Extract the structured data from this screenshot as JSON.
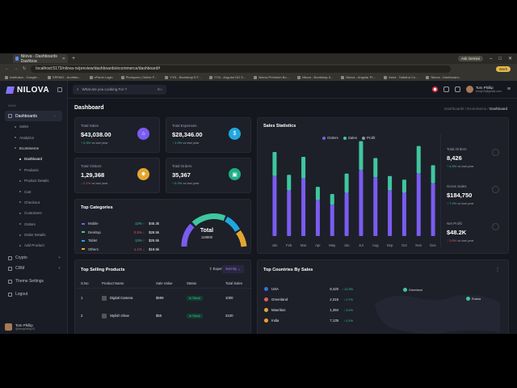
{
  "browser": {
    "tab_title": "Nilova - Dashboards Dashboa",
    "url": "localhost:5173/nilova-rs/preview/dashboards/ecommerce/dashboard#",
    "ask_label": "Ask Gemini",
    "work_label": "Work",
    "bookmarks": [
      "Institution - Google...",
      "SPEMO - Architec...",
      "cPanel Login",
      "Photopea | Online F...",
      "YYN - Bootstrap 5 F...",
      "YYN - Angular NG S...",
      "Nilova Premium Bo...",
      "Nilova - Bootstrap 5...",
      "Nilova - Angular Pr...",
      "Xstra - Tailwind Co...",
      "Nilova - Dashboard..."
    ]
  },
  "sidebar": {
    "logo": "NILOVA",
    "menu_heading": "MAIN",
    "items": [
      {
        "label": "Dashboards",
        "active": true
      },
      {
        "label": "Sales"
      },
      {
        "label": "Analytics"
      },
      {
        "label": "Ecommerce"
      }
    ],
    "sub_items": [
      "Dashboard",
      "Products",
      "Product Details",
      "Cart",
      "Checkout",
      "Customers",
      "Orders",
      "Order Details",
      "Add Product"
    ],
    "bottom_items": [
      "Crypto",
      "CRM",
      "Theme Settings",
      "Logout"
    ],
    "user": {
      "name": "Tom Phillip",
      "handle": "@tomphillip23"
    }
  },
  "topbar": {
    "search_placeholder": "What are you Looking For ?",
    "search_shortcut": "⌘K",
    "user_name": "Tom Phillip",
    "user_email": "tomp23@gmail.com"
  },
  "page": {
    "title": "Dashboard",
    "breadcrumb": [
      "Dashboards",
      "Ecommerce",
      "Dashboard"
    ]
  },
  "stats": [
    {
      "label": "Total Sales",
      "value": "$43,038.00",
      "change": "0.3%",
      "dir": "up",
      "suffix": "vs last year",
      "color": "#7a5cf0",
      "icon": "cart-icon"
    },
    {
      "label": "Total Expenses",
      "value": "$28,346.00",
      "change": "1.0%",
      "dir": "up",
      "suffix": "vs last year",
      "color": "#1fa7e0",
      "icon": "dollar-icon"
    },
    {
      "label": "Total Visitors",
      "value": "1,29,368",
      "change": "2.1%",
      "dir": "dn",
      "suffix": "vs last year",
      "color": "#e3a72f",
      "icon": "user-icon"
    },
    {
      "label": "Total Orders",
      "value": "35,367",
      "change": "0.2%",
      "dir": "up",
      "suffix": "vs last year",
      "color": "#1fae86",
      "icon": "box-icon"
    }
  ],
  "categories": {
    "title": "Top Categories",
    "rows": [
      {
        "name": "Mobile",
        "pct": "13% ↑",
        "amount": "$45.3k",
        "color": "#7a5cf0"
      },
      {
        "name": "Desktop",
        "pct": "0.5% ↓",
        "amount": "$28.5k",
        "color": "#3fc6a0"
      },
      {
        "name": "Tablet",
        "pct": "13% ↑",
        "amount": "$25.5k",
        "color": "#1fa7e0"
      },
      {
        "name": "Others",
        "pct": "1.1% ↓",
        "amount": "$19.6k",
        "color": "#e3a72f"
      }
    ],
    "total_label": "Total",
    "total_value": "118900"
  },
  "sales_stats": {
    "title": "Sales Statistics",
    "legend": [
      {
        "name": "Orders",
        "color": "#7a5cf0"
      },
      {
        "name": "Sales",
        "color": "#3fc6a0"
      },
      {
        "name": "Profit",
        "color": "#8e93a3"
      }
    ],
    "side": [
      {
        "label": "Total Orders",
        "value": "8,426",
        "change": "4.4%",
        "dir": "up",
        "suffix": "vs last year"
      },
      {
        "label": "Gross Sales",
        "value": "$184,750",
        "change": "7.2%",
        "dir": "up",
        "suffix": "vs last year"
      },
      {
        "label": "Net Profit",
        "value": "$48.2K",
        "change": "3.6%",
        "dir": "dn",
        "suffix": "vs last year"
      }
    ]
  },
  "chart_data": {
    "type": "bar",
    "categories": [
      "Jan",
      "Feb",
      "Mar",
      "Apr",
      "May",
      "Jun",
      "Jul",
      "Aug",
      "Sep",
      "Oct",
      "Nov",
      "Dec"
    ],
    "series": [
      {
        "name": "Orders",
        "values": [
          50,
          38,
          48,
          30,
          26,
          36,
          55,
          49,
          38,
          36,
          52,
          44
        ]
      },
      {
        "name": "Sales",
        "values": [
          20,
          13,
          18,
          11,
          9,
          16,
          24,
          16,
          12,
          11,
          23,
          15
        ]
      }
    ],
    "stacked": true,
    "ylim": [
      0,
      100
    ],
    "grid": false,
    "legend_position": "top"
  },
  "products": {
    "title": "Top Selling Products",
    "export_label": "Export",
    "sort_label": "Sort By",
    "columns": [
      "S.No",
      "Product Name",
      "Sale Value",
      "Status",
      "Total Sales"
    ],
    "rows": [
      {
        "no": "1",
        "name": "Digital Camera",
        "value": "$699",
        "status": "In Stock",
        "total": "1000"
      },
      {
        "no": "2",
        "name": "Stylish Shoe",
        "value": "$55",
        "status": "In Stock",
        "total": "3100"
      }
    ]
  },
  "countries": {
    "title": "Top Countries By Sales",
    "rows": [
      {
        "name": "USA",
        "value": "8,420",
        "pct": "↑ 12.9%",
        "color": "#3b6de0"
      },
      {
        "name": "Greenland",
        "value": "2,316",
        "pct": "↑ 0.7%",
        "color": "#e25c5c"
      },
      {
        "name": "Mauritius",
        "value": "1,284",
        "pct": "↑ 3.2%",
        "color": "#e3a72f"
      },
      {
        "name": "India",
        "value": "7,135",
        "pct": "↑ 2.1%",
        "color": "#ff9933"
      }
    ],
    "pins": [
      "Greenland",
      "Russia"
    ]
  }
}
